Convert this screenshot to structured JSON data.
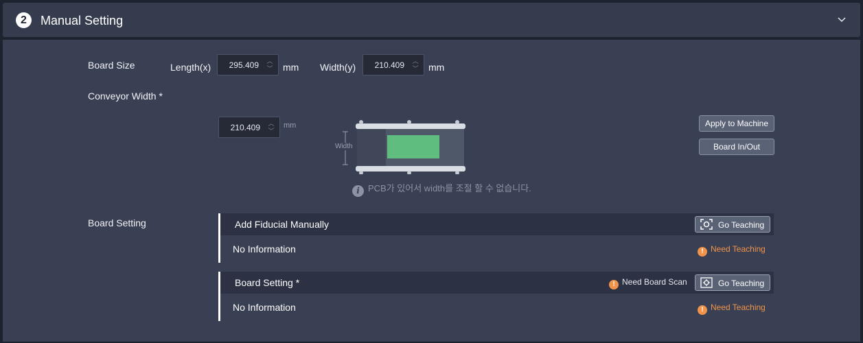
{
  "header": {
    "step": "2",
    "title": "Manual Setting",
    "collapse_icon": "chevron-down-icon"
  },
  "board_size": {
    "label": "Board Size",
    "length_label": "Length(x)",
    "length_value": "295.409",
    "length_unit": "mm",
    "width_label": "Width(y)",
    "width_value": "210.409",
    "width_unit": "mm"
  },
  "conveyor": {
    "label": "Conveyor Width *",
    "value": "210.409",
    "unit": "mm",
    "diagram_label": "Width",
    "note": "PCB가 있어서 width를 조절 할 수 없습니다.",
    "apply_button": "Apply to Machine",
    "board_io_button": "Board In/Out"
  },
  "board_setting": {
    "label": "Board Setting",
    "fiducial": {
      "title": "Add Fiducial Manually",
      "info": "No Information",
      "button": "Go Teaching",
      "status": "Need Teaching"
    },
    "board": {
      "title": "Board Setting *",
      "scan_status": "Need Board Scan",
      "info": "No Information",
      "button": "Go Teaching",
      "status": "Need Teaching"
    }
  },
  "colors": {
    "warning": "#f0934b",
    "pcb": "#5fbd7f",
    "panel": "#3a4053"
  }
}
